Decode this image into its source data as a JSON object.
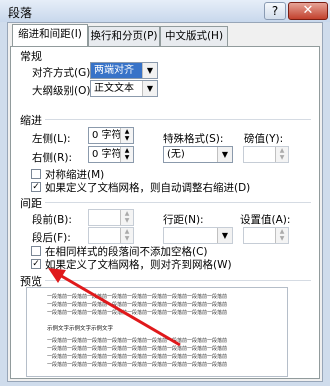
{
  "window": {
    "title": "段落",
    "help": "?",
    "close": "✕"
  },
  "tabs": [
    {
      "label": "缩进和间距(I)",
      "active": true
    },
    {
      "label": "换行和分页(P)",
      "active": false
    },
    {
      "label": "中文版式(H)",
      "active": false
    }
  ],
  "general": {
    "heading": "常规",
    "align_label": "对齐方式(G):",
    "align_value": "两端对齐",
    "outline_label": "大纲级别(O):",
    "outline_value": "正文文本"
  },
  "indent": {
    "heading": "缩进",
    "left_label": "左侧(L):",
    "left_value": "0 字符",
    "right_label": "右侧(R):",
    "right_value": "0 字符",
    "special_label": "特殊格式(S):",
    "special_value": "(无)",
    "measure_label": "磅值(Y):",
    "mirror_label": "对称缩进(M)",
    "mirror_checked": false,
    "auto_label": "如果定义了文档网格，则自动调整右缩进(D)",
    "auto_checked": true
  },
  "spacing": {
    "heading": "间距",
    "before_label": "段前(B):",
    "after_label": "段后(F):",
    "line_label": "行距(N):",
    "set_label": "设置值(A):",
    "nospace_label": "在相同样式的段落间不添加空格(C)",
    "nospace_checked": false,
    "grid_label": "如果定义了文档网格，则对齐到网格(W)",
    "grid_checked": true
  },
  "preview": {
    "heading": "预览",
    "sample_text": "示例文字示例文字示例文字",
    "line_text": "一段落前一段落前一段落前一段落前一段落前一段落前一段落前一段落前一段落前"
  },
  "icons": {
    "check": "✓",
    "dropdown": "▼",
    "up": "▲",
    "down": "▼"
  },
  "annotation_color": "#e0191b"
}
